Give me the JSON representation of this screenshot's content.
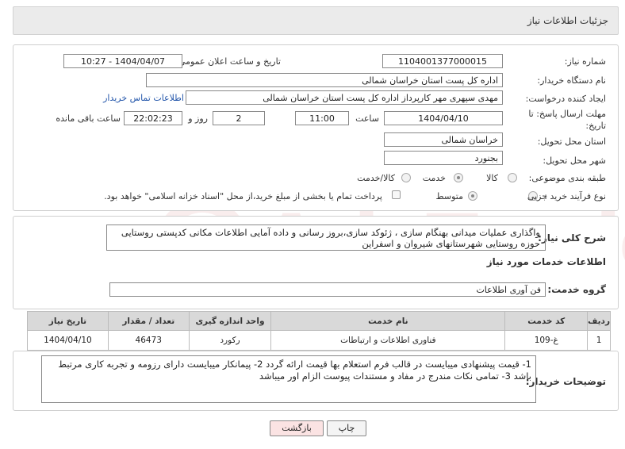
{
  "page": {
    "title": "جزئیات اطلاعات نیاز"
  },
  "form": {
    "need_number_label": "شماره نیاز:",
    "need_number": "1104001377000015",
    "announce_label": "تاریخ و ساعت اعلان عمومی:",
    "announce_value": "1404/04/07 - 10:27",
    "buyer_org_label": "نام دستگاه خریدار:",
    "buyer_org": "اداره کل پست استان خراسان شمالی",
    "requester_label": "ایجاد کننده درخواست:",
    "requester": "مهدی سپهری مهر کارپرداز اداره کل پست استان خراسان شمالی",
    "contact_link": "اطلاعات تماس خریدار",
    "deadline_label": "مهلت ارسال پاسخ: تا تاریخ:",
    "deadline_date": "1404/04/10",
    "time_label": "ساعت",
    "deadline_time": "11:00",
    "days_value": "2",
    "days_label": "روز و",
    "remaining_time": "22:02:23",
    "remaining_label": "ساعت باقی مانده",
    "province_label": "استان محل تحویل:",
    "province": "خراسان شمالی",
    "city_label": "شهر محل تحویل:",
    "city": "بجنورد",
    "category_label": "طبقه بندی موضوعی:",
    "category_options": [
      "کالا",
      "خدمت",
      "کالا/خدمت"
    ],
    "category_selected": "خدمت",
    "process_label": "نوع فرآیند خرید :",
    "process_options": [
      "جزیی",
      "متوسط"
    ],
    "process_selected": "متوسط",
    "treasury_note": "پرداخت تمام یا بخشی از مبلغ خرید،از محل \"اسناد خزانه اسلامی\" خواهد بود."
  },
  "description": {
    "label": "شرح کلی نیاز:",
    "text": "واگذاری عملیات میدانی بهنگام سازی ، ژئوکد سازی،بروز رسانی و داده آمایی اطلاعات مکانی کدپستی روستایی حوزه روستایی شهرستانهای شیروان و اسفراین"
  },
  "services": {
    "section_title": "اطلاعات خدمات مورد نیاز",
    "group_label": "گروه خدمت:",
    "group_value": "فن آوری اطلاعات",
    "columns": [
      "ردیف",
      "کد خدمت",
      "نام خدمت",
      "واحد اندازه گیری",
      "تعداد / مقدار",
      "تاریخ نیاز"
    ],
    "rows": [
      [
        "1",
        "غ-109",
        "فناوری اطلاعات و ارتباطات",
        "رکورد",
        "46473",
        "1404/04/10"
      ]
    ]
  },
  "buyer_notes": {
    "label": "توضیحات خریدار:",
    "text": "1- قیمت پیشنهادی میبایست در قالب فرم استعلام بها قیمت ارائه گردد 2- پیمانکار میبایست دارای رزومه و تجربه کاری مرتبط باشد 3- تمامی نکات مندرج در مفاد و مستندات پیوست الزام اور میباشد"
  },
  "buttons": {
    "print": "چاپ",
    "back": "بازگشت"
  },
  "colors": {
    "header_bg": "#ebebeb",
    "link": "#2255aa",
    "table_header_bg": "#d9d9d9",
    "back_button_bg": "#fbe3e3"
  }
}
